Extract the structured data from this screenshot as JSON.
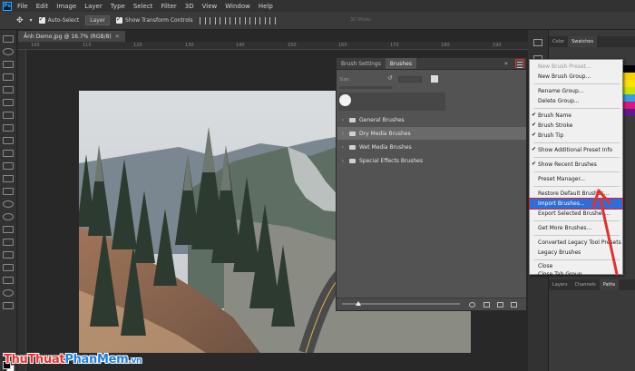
{
  "menubar": {
    "app_icon": "Ps",
    "items": [
      "File",
      "Edit",
      "Image",
      "Layer",
      "Type",
      "Select",
      "Filter",
      "3D",
      "View",
      "Window",
      "Help"
    ]
  },
  "options_bar": {
    "auto_select_label": "Auto-Select",
    "auto_select_target": "Layer",
    "transform_controls_label": "Show Transform Controls",
    "mode_3d_label": "3D Mode:"
  },
  "document": {
    "tab_title": "Ảnh Demo.jpg @ 16.7% (RGB/8)",
    "ruler_ticks": [
      "100",
      "110",
      "120",
      "130",
      "140",
      "150",
      "160",
      "170",
      "180",
      "190"
    ]
  },
  "brush_panel": {
    "tabs": [
      "Brush Settings",
      "Brushes"
    ],
    "active_tab": "Brushes",
    "collapse_glyph": "»",
    "size_label": "Size:",
    "folders": [
      {
        "label": "General Brushes",
        "selected": false
      },
      {
        "label": "Dry Media Brushes",
        "selected": true
      },
      {
        "label": "Wet Media Brushes",
        "selected": false
      },
      {
        "label": "Special Effects Brushes",
        "selected": false
      }
    ]
  },
  "right_panel": {
    "top_tabs": [
      "Color",
      "Swatches"
    ],
    "active_top_tab": "Swatches",
    "bottom_tabs": [
      "Layers",
      "Channels",
      "Paths"
    ],
    "active_bottom_tab": "Paths"
  },
  "flyout_menu": {
    "items": [
      {
        "label": "New Brush Preset...",
        "checked": false,
        "disabled": true,
        "highlighted": false
      },
      {
        "label": "New Brush Group...",
        "checked": false,
        "disabled": false,
        "highlighted": false
      },
      {
        "label": "Rename Group...",
        "checked": false,
        "disabled": false,
        "highlighted": false
      },
      {
        "label": "Delete Group...",
        "checked": false,
        "disabled": false,
        "highlighted": false
      },
      {
        "label": "Brush Name",
        "checked": true,
        "disabled": false,
        "highlighted": false
      },
      {
        "label": "Brush Stroke",
        "checked": true,
        "disabled": false,
        "highlighted": false
      },
      {
        "label": "Brush Tip",
        "checked": true,
        "disabled": false,
        "highlighted": false
      },
      {
        "label": "Show Additional Preset Info",
        "checked": true,
        "disabled": false,
        "highlighted": false
      },
      {
        "label": "Show Recent Brushes",
        "checked": true,
        "disabled": false,
        "highlighted": false
      },
      {
        "label": "Preset Manager...",
        "checked": false,
        "disabled": false,
        "highlighted": false
      },
      {
        "label": "Restore Default Brushes...",
        "checked": false,
        "disabled": false,
        "highlighted": false
      },
      {
        "label": "Import Brushes...",
        "checked": false,
        "disabled": false,
        "highlighted": true
      },
      {
        "label": "Export Selected Brushes...",
        "checked": false,
        "disabled": false,
        "highlighted": false
      },
      {
        "label": "Get More Brushes...",
        "checked": false,
        "disabled": false,
        "highlighted": false
      },
      {
        "label": "Converted Legacy Tool Presets",
        "checked": false,
        "disabled": false,
        "highlighted": false
      },
      {
        "label": "Legacy Brushes",
        "checked": false,
        "disabled": false,
        "highlighted": false
      },
      {
        "label": "Close",
        "checked": false,
        "disabled": false,
        "highlighted": false
      },
      {
        "label": "Close Tab Group",
        "checked": false,
        "disabled": false,
        "highlighted": false
      }
    ]
  },
  "watermark": {
    "part1": "ThuThuat",
    "part2": "PhanMem",
    "part3": ".vn"
  },
  "colors": {
    "accent_highlight": "#2a6fdb",
    "annotation_red": "#e53030",
    "panel_bg": "#535353",
    "app_bg": "#282828"
  }
}
